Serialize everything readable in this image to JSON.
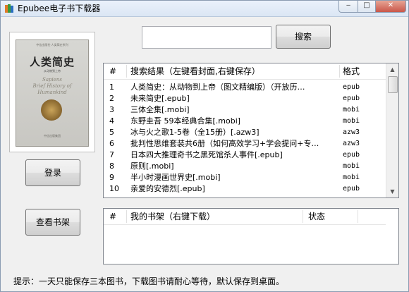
{
  "window": {
    "title": "Epubee电子书下载器",
    "min_glyph": "‒",
    "max_glyph": "□",
    "close_glyph": "✕"
  },
  "cover": {
    "series_top": "中信出版社·人类简史系列",
    "title": "人类简史",
    "subtitle": "从动物到上帝",
    "en_lines": [
      "Sapiens",
      "Brief History of",
      "Humankind"
    ],
    "footer": "中信出版集团"
  },
  "search": {
    "input_value": "",
    "button_label": "搜索"
  },
  "buttons": {
    "login": "登录",
    "shelf": "查看书架"
  },
  "results": {
    "col_num": "#",
    "col_title": "搜索结果（左键看封面,右键保存）",
    "col_format": "格式",
    "rows": [
      {
        "num": "1",
        "title": "人类简史：从动物到上帝（图文精编版）（开放历…",
        "format": "epub"
      },
      {
        "num": "2",
        "title": "未来简史[.epub]",
        "format": "epub"
      },
      {
        "num": "3",
        "title": "三体全集[.mobi]",
        "format": "mobi"
      },
      {
        "num": "4",
        "title": "东野圭吾 59本经典合集[.mobi]",
        "format": "mobi"
      },
      {
        "num": "5",
        "title": "冰与火之歌1-5卷（全15册）[.azw3]",
        "format": "azw3"
      },
      {
        "num": "6",
        "title": "批判性思维套装共6册（如何高效学习+学会提问+专…",
        "format": "azw3"
      },
      {
        "num": "7",
        "title": "日本四大推理奇书之黑死馆杀人事件[.epub]",
        "format": "epub"
      },
      {
        "num": "8",
        "title": "原则[.mobi]",
        "format": "mobi"
      },
      {
        "num": "9",
        "title": "半小时漫画世界史[.mobi]",
        "format": "mobi"
      },
      {
        "num": "10",
        "title": "亲爱的安德烈[.epub]",
        "format": "epub"
      }
    ]
  },
  "shelf": {
    "col_num": "#",
    "col_title": "我的书架（右键下载）",
    "col_status": "状态"
  },
  "status_text": "提示：一天只能保存三本图书，下载图书请耐心等待，默认保存到桌面。",
  "colors": {
    "window_bg": "#f0f0f0",
    "title_bar": "#dbe6f4",
    "close_button": "#c9574a",
    "list_bg": "#ffffff"
  }
}
